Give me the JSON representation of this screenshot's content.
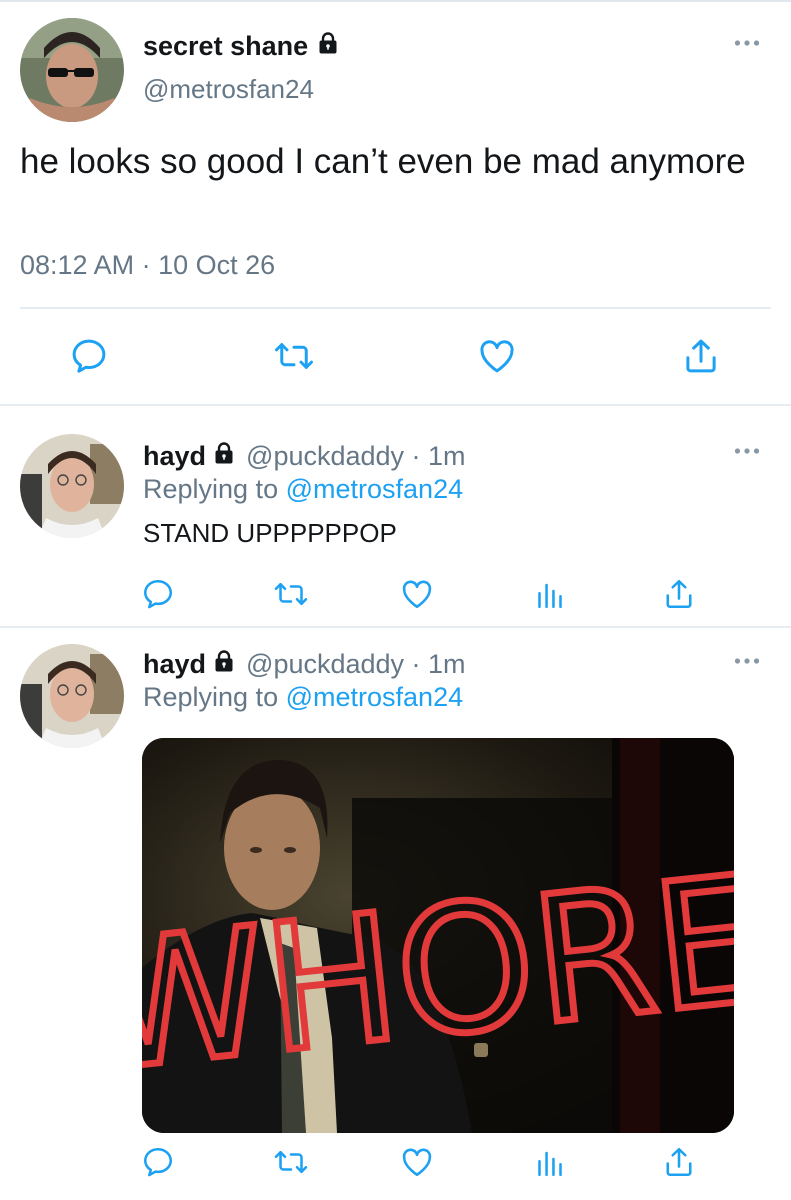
{
  "main_tweet": {
    "display_name": "secret shane",
    "handle": "@metrosfan24",
    "text": "he looks so good I can’t even be mad anymore",
    "timestamp": "08:12 AM · 10 Oct 26"
  },
  "replies": [
    {
      "display_name": "hayd",
      "handle_time": "@puckdaddy · 1m",
      "replying_prefix": "Replying to",
      "replying_to": "@metrosfan24",
      "text": "STAND UPPPPPPOP"
    },
    {
      "display_name": "hayd",
      "handle_time": "@puckdaddy · 1m",
      "replying_prefix": "Replying to",
      "replying_to": "@metrosfan24",
      "media_text": "WHORE"
    }
  ],
  "colors": {
    "text": "#14171a",
    "secondary": "#657786",
    "link": "#1da1f2",
    "divider": "#e6ecf0",
    "icon": "#1da1f2"
  },
  "icons": [
    "lock-icon",
    "more-icon",
    "reply-icon",
    "retweet-icon",
    "like-icon",
    "analytics-icon",
    "share-icon"
  ]
}
